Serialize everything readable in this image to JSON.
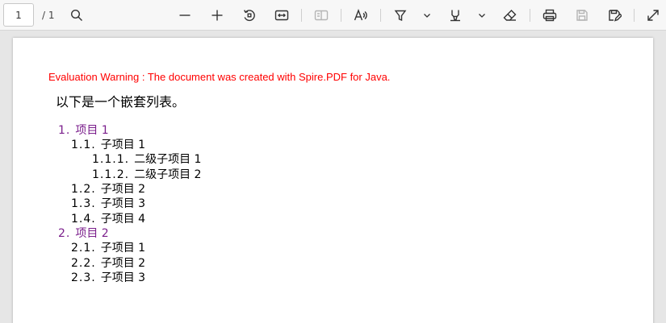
{
  "toolbar": {
    "page_current": "1",
    "page_total": "/ 1",
    "buttons": [
      {
        "name": "search-icon",
        "icon": "search"
      },
      {
        "name": "zoom-out-icon",
        "icon": "minus"
      },
      {
        "name": "zoom-in-icon",
        "icon": "plus"
      },
      {
        "name": "rotate-icon",
        "icon": "rotate"
      },
      {
        "name": "fit-width-icon",
        "icon": "fit"
      },
      {
        "name": "two-page-icon",
        "icon": "pages"
      },
      {
        "name": "read-aloud-icon",
        "icon": "read-aloud"
      },
      {
        "name": "highlight-icon",
        "icon": "highlight"
      },
      {
        "name": "draw-icon",
        "icon": "draw"
      },
      {
        "name": "erase-icon",
        "icon": "erase"
      },
      {
        "name": "print-icon",
        "icon": "print"
      },
      {
        "name": "save-icon",
        "icon": "save"
      },
      {
        "name": "save-as-icon",
        "icon": "save-as"
      },
      {
        "name": "fullscreen-icon",
        "icon": "fullscreen"
      }
    ],
    "colors": {
      "icon": "#333333",
      "icon_disabled": "#b5b5b5"
    }
  },
  "document": {
    "warning": "Evaluation Warning : The document was created with Spire.PDF for Java.",
    "heading": "以下是一个嵌套列表。",
    "items": [
      {
        "num": "1.",
        "text": "项目 1",
        "level": 1
      },
      {
        "num": "1.1.",
        "text": "子项目 1",
        "level": 2
      },
      {
        "num": "1.1.1.",
        "text": "二级子项目 1",
        "level": 3
      },
      {
        "num": "1.1.2.",
        "text": "二级子项目 2",
        "level": 3
      },
      {
        "num": "1.2.",
        "text": "子项目 2",
        "level": 2
      },
      {
        "num": "1.3.",
        "text": "子项目 3",
        "level": 2
      },
      {
        "num": "1.4.",
        "text": "子项目 4",
        "level": 2
      },
      {
        "num": "2.",
        "text": "项目 2",
        "level": 1
      },
      {
        "num": "2.1.",
        "text": "子项目 1",
        "level": 2
      },
      {
        "num": "2.2.",
        "text": "子项目 2",
        "level": 2
      },
      {
        "num": "2.3.",
        "text": "子项目 3",
        "level": 2
      }
    ],
    "colors": {
      "warning": "#ff0000",
      "level1": "#7b1f8c",
      "text": "#000000"
    }
  }
}
